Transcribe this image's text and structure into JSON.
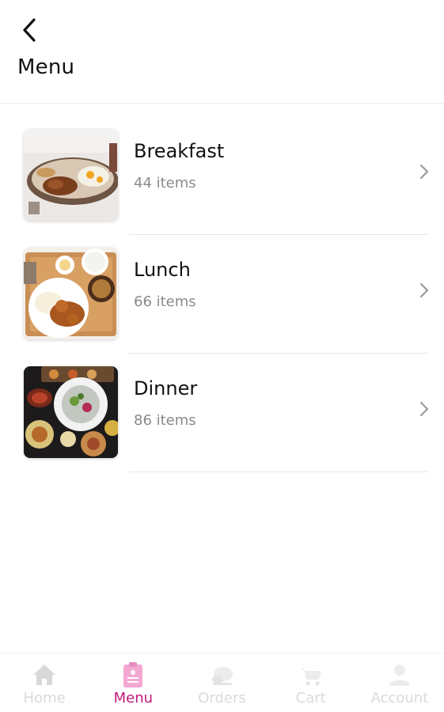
{
  "header": {
    "back_icon": "chevron-left-icon",
    "title": "Menu"
  },
  "categories": [
    {
      "name": "Breakfast",
      "count": "44 items",
      "image": "breakfast-plate"
    },
    {
      "name": "Lunch",
      "count": "66 items",
      "image": "lunch-tray"
    },
    {
      "name": "Dinner",
      "count": "86 items",
      "image": "dinner-spread"
    }
  ],
  "nav": {
    "active": "Menu",
    "active_color": "#c2187a",
    "inactive_color": "#dadada",
    "items": [
      {
        "label": "Home",
        "icon": "home-icon"
      },
      {
        "label": "Menu",
        "icon": "menu-clipboard-icon"
      },
      {
        "label": "Orders",
        "icon": "orders-icon"
      },
      {
        "label": "Cart",
        "icon": "cart-icon"
      },
      {
        "label": "Account",
        "icon": "account-icon"
      }
    ]
  }
}
